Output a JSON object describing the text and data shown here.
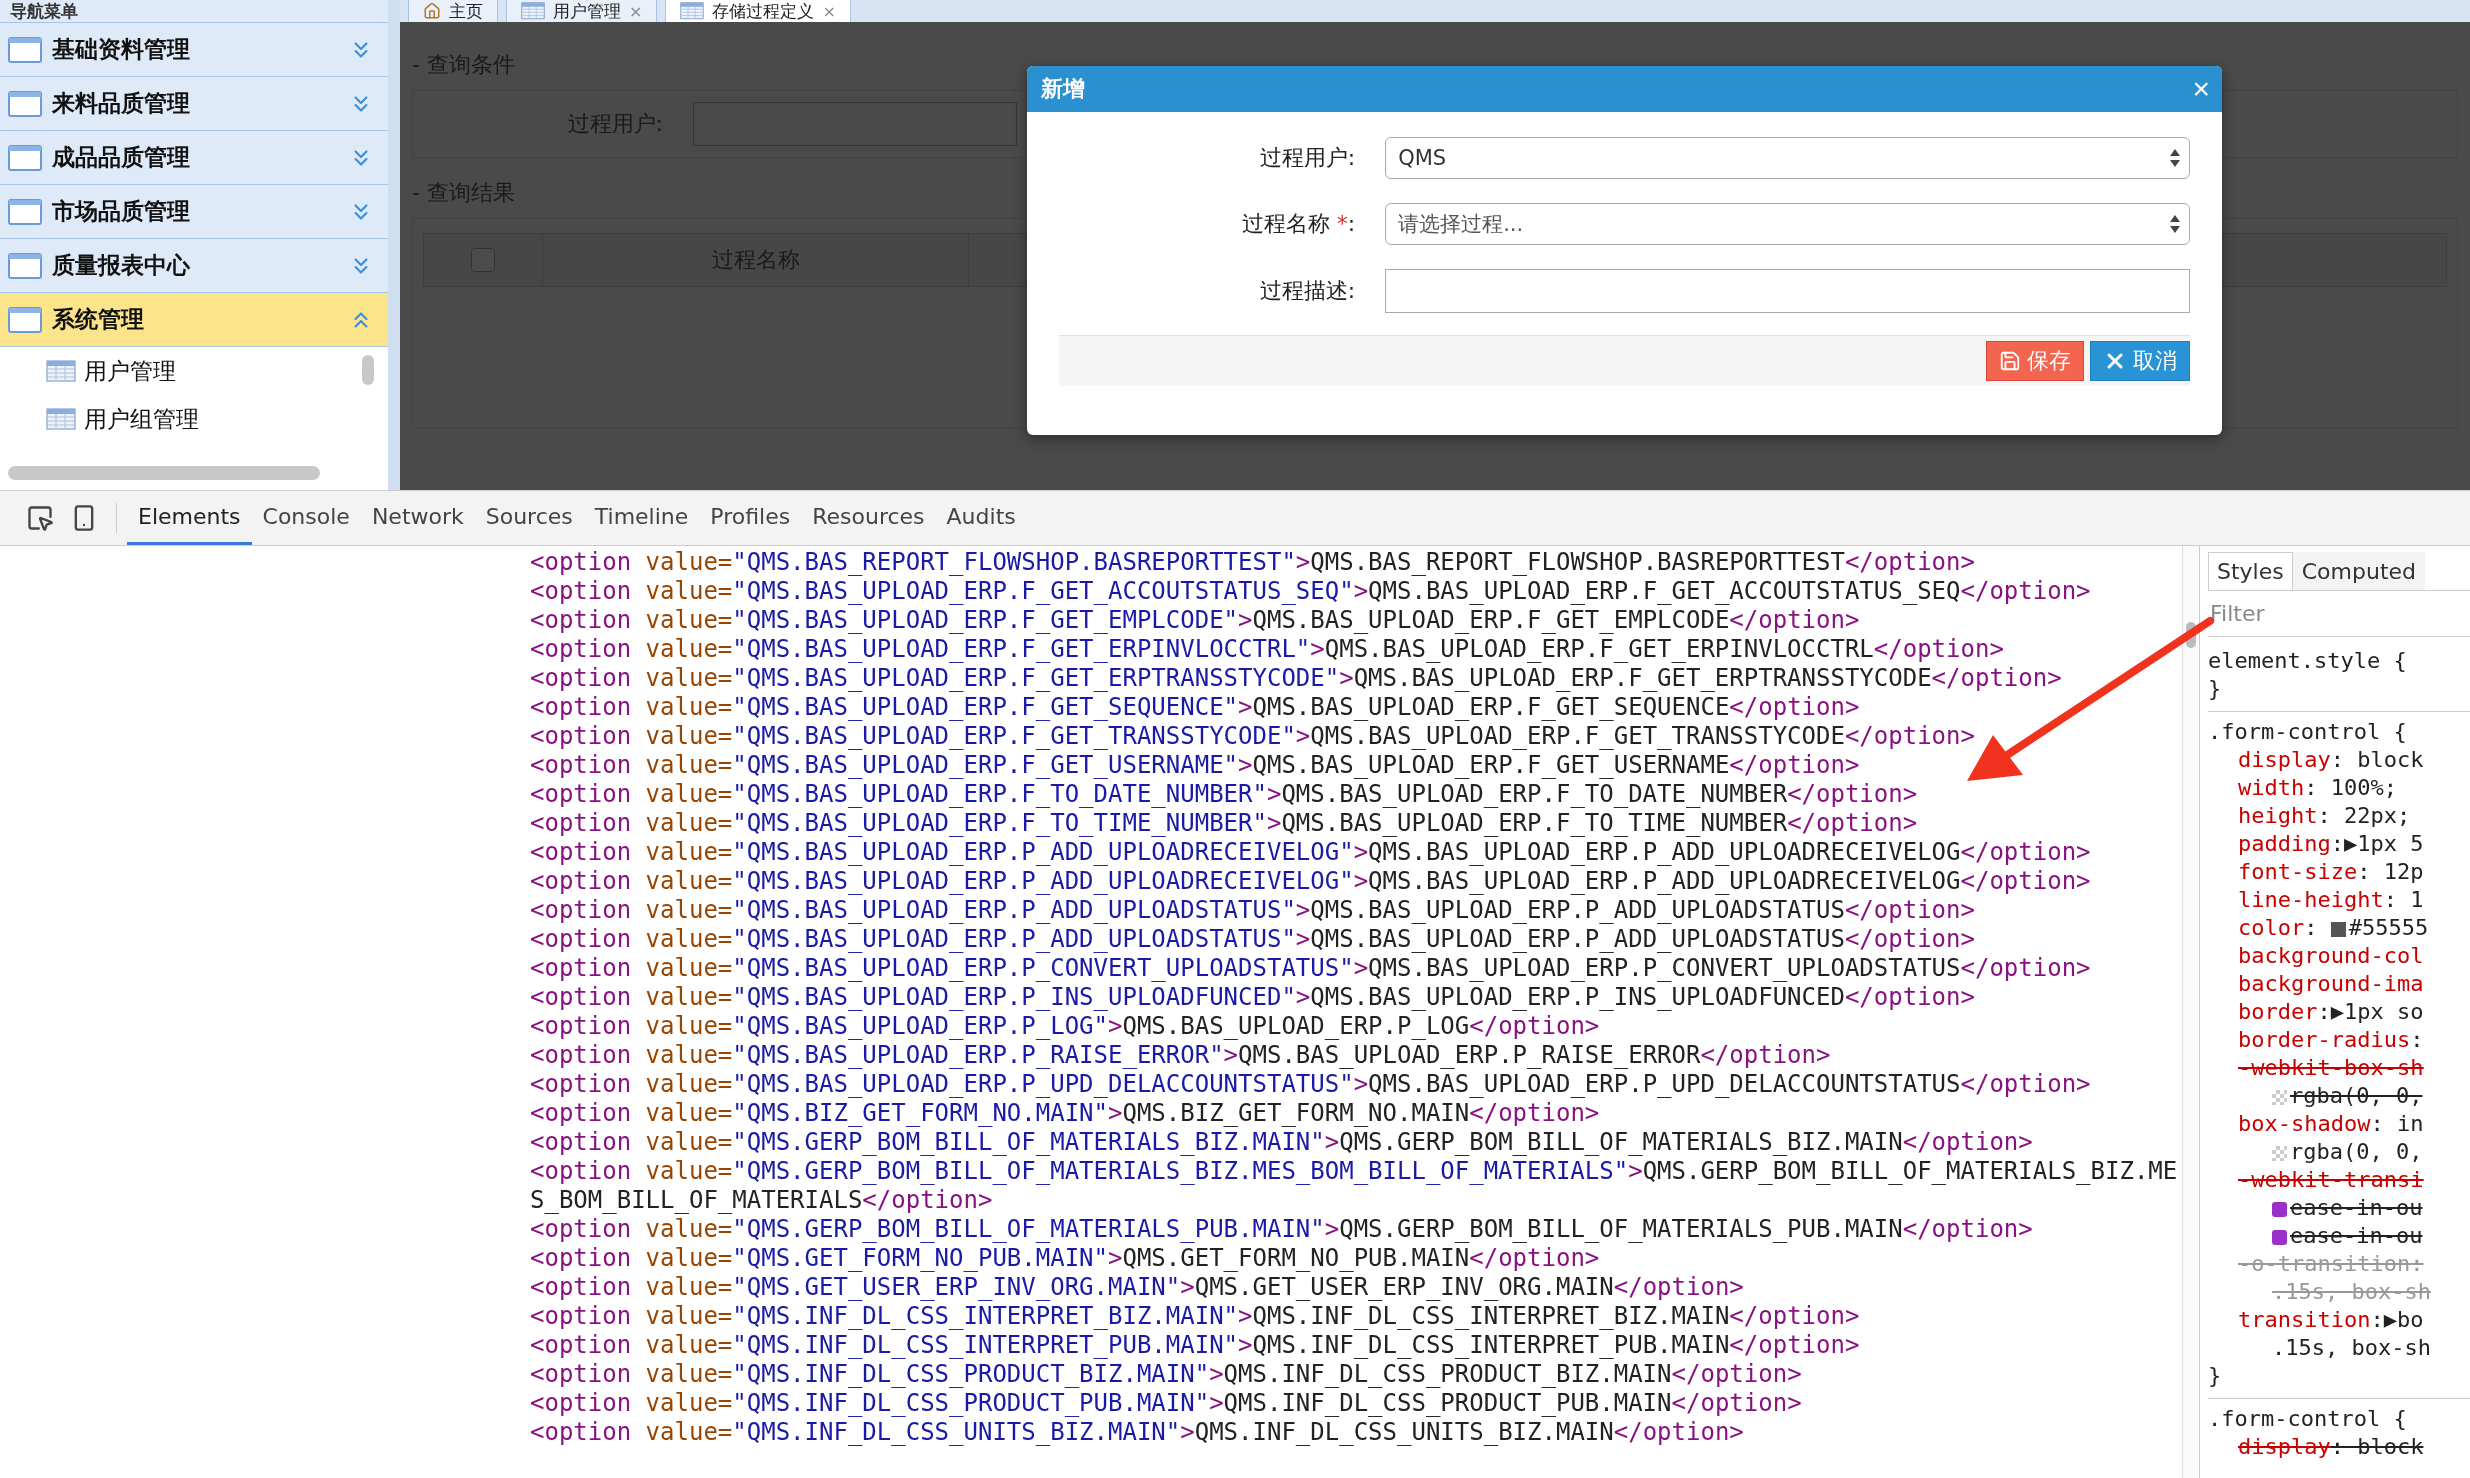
{
  "sidebar": {
    "title": "导航菜单",
    "items": [
      {
        "label": "基础资料管理",
        "expanded": false
      },
      {
        "label": "来料品质管理",
        "expanded": false
      },
      {
        "label": "成品品质管理",
        "expanded": false
      },
      {
        "label": "市场品质管理",
        "expanded": false
      },
      {
        "label": "质量报表中心",
        "expanded": false
      },
      {
        "label": "系统管理",
        "expanded": true,
        "children": [
          {
            "label": "用户管理"
          },
          {
            "label": "用户组管理"
          }
        ]
      }
    ]
  },
  "tabs": [
    {
      "label": "主页",
      "selected": false
    },
    {
      "label": "用户管理",
      "close": "×",
      "selected": false
    },
    {
      "label": "存储过程定义",
      "close": "×",
      "selected": true
    }
  ],
  "query": {
    "title": "- 查询条件",
    "field_label": "过程用户:"
  },
  "results": {
    "title": "- 查询结果",
    "columns": [
      {
        "kind": "checkbox",
        "checked": false
      },
      {
        "kind": "text",
        "label": "过程名称"
      }
    ]
  },
  "dialog": {
    "title": "新增",
    "close": "×",
    "fields": [
      {
        "kind": "select",
        "label": "过程用户",
        "colon": ":",
        "value": "QMS"
      },
      {
        "kind": "select",
        "label": "过程名称",
        "required_mark": "*",
        "colon": ":",
        "placeholder": "请选择过程..."
      },
      {
        "kind": "text",
        "label": "过程描述",
        "colon": ":"
      }
    ],
    "buttons": [
      {
        "label": "保存",
        "kind": "save"
      },
      {
        "label": "取消",
        "kind": "cancel"
      }
    ]
  },
  "devtools": {
    "tabs": [
      {
        "label": "Elements",
        "selected": true
      },
      {
        "label": "Console",
        "selected": false
      },
      {
        "label": "Network",
        "selected": false
      },
      {
        "label": "Sources",
        "selected": false
      },
      {
        "label": "Timeline",
        "selected": false
      },
      {
        "label": "Profiles",
        "selected": false
      },
      {
        "label": "Resources",
        "selected": false
      },
      {
        "label": "Audits",
        "selected": false
      }
    ],
    "code_lines": [
      {
        "open": "<option",
        "attr": "value=",
        "value": "\"QMS.BAS_REPORT_FLOWSHOP.BASREPORTTEST\"",
        "gt": ">",
        "text": "QMS.BAS_REPORT_FLOWSHOP.BASREPORTTEST",
        "close": "</option>"
      },
      {
        "open": "<option",
        "attr": "value=",
        "value": "\"QMS.BAS_UPLOAD_ERP.F_GET_ACCOUTSTATUS_SEQ\"",
        "gt": ">",
        "text": "QMS.BAS_UPLOAD_ERP.F_GET_ACCOUTSTATUS_SEQ",
        "close": "</option>"
      },
      {
        "open": "<option",
        "attr": "value=",
        "value": "\"QMS.BAS_UPLOAD_ERP.F_GET_EMPLCODE\"",
        "gt": ">",
        "text": "QMS.BAS_UPLOAD_ERP.F_GET_EMPLCODE",
        "close": "</option>"
      },
      {
        "open": "<option",
        "attr": "value=",
        "value": "\"QMS.BAS_UPLOAD_ERP.F_GET_ERPINVLOCCTRL\"",
        "gt": ">",
        "text": "QMS.BAS_UPLOAD_ERP.F_GET_ERPINVLOCCTRL",
        "close": "</option>"
      },
      {
        "open": "<option",
        "attr": "value=",
        "value": "\"QMS.BAS_UPLOAD_ERP.F_GET_ERPTRANSSTYCODE\"",
        "gt": ">",
        "text": "QMS.BAS_UPLOAD_ERP.F_GET_ERPTRANSSTYCODE",
        "close": "</option>"
      },
      {
        "open": "<option",
        "attr": "value=",
        "value": "\"QMS.BAS_UPLOAD_ERP.F_GET_SEQUENCE\"",
        "gt": ">",
        "text": "QMS.BAS_UPLOAD_ERP.F_GET_SEQUENCE",
        "close": "</option>"
      },
      {
        "open": "<option",
        "attr": "value=",
        "value": "\"QMS.BAS_UPLOAD_ERP.F_GET_TRANSSTYCODE\"",
        "gt": ">",
        "text": "QMS.BAS_UPLOAD_ERP.F_GET_TRANSSTYCODE",
        "close": "</option>"
      },
      {
        "open": "<option",
        "attr": "value=",
        "value": "\"QMS.BAS_UPLOAD_ERP.F_GET_USERNAME\"",
        "gt": ">",
        "text": "QMS.BAS_UPLOAD_ERP.F_GET_USERNAME",
        "close": "</option>"
      },
      {
        "open": "<option",
        "attr": "value=",
        "value": "\"QMS.BAS_UPLOAD_ERP.F_TO_DATE_NUMBER\"",
        "gt": ">",
        "text": "QMS.BAS_UPLOAD_ERP.F_TO_DATE_NUMBER",
        "close": "</option>"
      },
      {
        "open": "<option",
        "attr": "value=",
        "value": "\"QMS.BAS_UPLOAD_ERP.F_TO_TIME_NUMBER\"",
        "gt": ">",
        "text": "QMS.BAS_UPLOAD_ERP.F_TO_TIME_NUMBER",
        "close": "</option>"
      },
      {
        "open": "<option",
        "attr": "value=",
        "value": "\"QMS.BAS_UPLOAD_ERP.P_ADD_UPLOADRECEIVELOG\"",
        "gt": ">",
        "text": "QMS.BAS_UPLOAD_ERP.P_ADD_UPLOADRECEIVELOG",
        "close": "</option>"
      },
      {
        "open": "<option",
        "attr": "value=",
        "value": "\"QMS.BAS_UPLOAD_ERP.P_ADD_UPLOADRECEIVELOG\"",
        "gt": ">",
        "text": "QMS.BAS_UPLOAD_ERP.P_ADD_UPLOADRECEIVELOG",
        "close": "</option>"
      },
      {
        "open": "<option",
        "attr": "value=",
        "value": "\"QMS.BAS_UPLOAD_ERP.P_ADD_UPLOADSTATUS\"",
        "gt": ">",
        "text": "QMS.BAS_UPLOAD_ERP.P_ADD_UPLOADSTATUS",
        "close": "</option>"
      },
      {
        "open": "<option",
        "attr": "value=",
        "value": "\"QMS.BAS_UPLOAD_ERP.P_ADD_UPLOADSTATUS\"",
        "gt": ">",
        "text": "QMS.BAS_UPLOAD_ERP.P_ADD_UPLOADSTATUS",
        "close": "</option>"
      },
      {
        "open": "<option",
        "attr": "value=",
        "value": "\"QMS.BAS_UPLOAD_ERP.P_CONVERT_UPLOADSTATUS\"",
        "gt": ">",
        "text": "QMS.BAS_UPLOAD_ERP.P_CONVERT_UPLOADSTATUS",
        "close": "</option>"
      },
      {
        "open": "<option",
        "attr": "value=",
        "value": "\"QMS.BAS_UPLOAD_ERP.P_INS_UPLOADFUNCED\"",
        "gt": ">",
        "text": "QMS.BAS_UPLOAD_ERP.P_INS_UPLOADFUNCED",
        "close": "</option>"
      },
      {
        "open": "<option",
        "attr": "value=",
        "value": "\"QMS.BAS_UPLOAD_ERP.P_LOG\"",
        "gt": ">",
        "text": "QMS.BAS_UPLOAD_ERP.P_LOG",
        "close": "</option>"
      },
      {
        "open": "<option",
        "attr": "value=",
        "value": "\"QMS.BAS_UPLOAD_ERP.P_RAISE_ERROR\"",
        "gt": ">",
        "text": "QMS.BAS_UPLOAD_ERP.P_RAISE_ERROR",
        "close": "</option>"
      },
      {
        "open": "<option",
        "attr": "value=",
        "value": "\"QMS.BAS_UPLOAD_ERP.P_UPD_DELACCOUNTSTATUS\"",
        "gt": ">",
        "text": "QMS.BAS_UPLOAD_ERP.P_UPD_DELACCOUNTSTATUS",
        "close": "</option>"
      },
      {
        "open": "<option",
        "attr": "value=",
        "value": "\"QMS.BIZ_GET_FORM_NO.MAIN\"",
        "gt": ">",
        "text": "QMS.BIZ_GET_FORM_NO.MAIN",
        "close": "</option>"
      },
      {
        "open": "<option",
        "attr": "value=",
        "value": "\"QMS.GERP_BOM_BILL_OF_MATERIALS_BIZ.MAIN\"",
        "gt": ">",
        "text": "QMS.GERP_BOM_BILL_OF_MATERIALS_BIZ.MAIN",
        "close": "</option>"
      },
      {
        "open": "<option",
        "attr": "value=",
        "value": "\"QMS.GERP_BOM_BILL_OF_MATERIALS_BIZ.MES_BOM_BILL_OF_MATERIALS\"",
        "gt": ">",
        "text": "QMS.GERP_BOM_BILL_OF_MATERIALS_BIZ.MES_BOM_BILL_OF_MATERIALS",
        "close": "</option>"
      },
      {
        "open": "<option",
        "attr": "value=",
        "value": "\"QMS.GERP_BOM_BILL_OF_MATERIALS_PUB.MAIN\"",
        "gt": ">",
        "text": "QMS.GERP_BOM_BILL_OF_MATERIALS_PUB.MAIN",
        "close": "</option>"
      },
      {
        "open": "<option",
        "attr": "value=",
        "value": "\"QMS.GET_FORM_NO_PUB.MAIN\"",
        "gt": ">",
        "text": "QMS.GET_FORM_NO_PUB.MAIN",
        "close": "</option>"
      },
      {
        "open": "<option",
        "attr": "value=",
        "value": "\"QMS.GET_USER_ERP_INV_ORG.MAIN\"",
        "gt": ">",
        "text": "QMS.GET_USER_ERP_INV_ORG.MAIN",
        "close": "</option>"
      },
      {
        "open": "<option",
        "attr": "value=",
        "value": "\"QMS.INF_DL_CSS_INTERPRET_BIZ.MAIN\"",
        "gt": ">",
        "text": "QMS.INF_DL_CSS_INTERPRET_BIZ.MAIN",
        "close": "</option>"
      },
      {
        "open": "<option",
        "attr": "value=",
        "value": "\"QMS.INF_DL_CSS_INTERPRET_PUB.MAIN\"",
        "gt": ">",
        "text": "QMS.INF_DL_CSS_INTERPRET_PUB.MAIN",
        "close": "</option>"
      },
      {
        "open": "<option",
        "attr": "value=",
        "value": "\"QMS.INF_DL_CSS_PRODUCT_BIZ.MAIN\"",
        "gt": ">",
        "text": "QMS.INF_DL_CSS_PRODUCT_BIZ.MAIN",
        "close": "</option>"
      },
      {
        "open": "<option",
        "attr": "value=",
        "value": "\"QMS.INF_DL_CSS_PRODUCT_PUB.MAIN\"",
        "gt": ">",
        "text": "QMS.INF_DL_CSS_PRODUCT_PUB.MAIN",
        "close": "</option>"
      },
      {
        "open": "<option",
        "attr": "value=",
        "value": "\"QMS.INF_DL_CSS_UNITS_BIZ.MAIN\"",
        "gt": ">",
        "text": "QMS.INF_DL_CSS_UNITS_BIZ.MAIN",
        "close": "</option>"
      }
    ],
    "styles_panel": {
      "tabs": [
        {
          "label": "Styles",
          "selected": true
        },
        {
          "label": "Computed",
          "selected": false
        }
      ],
      "filter_placeholder": "Filter",
      "lines": [
        {
          "kind": "selector",
          "text": "element.style {",
          "divider": false
        },
        {
          "kind": "brace",
          "text": "}"
        },
        {
          "kind": "selector",
          "text": ".form-control {",
          "divider": true
        },
        {
          "kind": "decl",
          "prop": "display",
          "value": ": block",
          "struck": false,
          "dimmed": false
        },
        {
          "kind": "decl",
          "prop": "width",
          "value": ": 100%;",
          "struck": false,
          "dimmed": false
        },
        {
          "kind": "decl",
          "prop": "height",
          "value": ": 22px;",
          "struck": false,
          "dimmed": false
        },
        {
          "kind": "decl",
          "prop": "padding",
          "value": ":▶1px 5",
          "struck": false,
          "dimmed": false
        },
        {
          "kind": "decl",
          "prop": "font-size",
          "value": ": 12p",
          "struck": false,
          "dimmed": false
        },
        {
          "kind": "decl",
          "prop": "line-height",
          "value": ": 1",
          "struck": false,
          "dimmed": false
        },
        {
          "kind": "color_decl",
          "prop": "color",
          "value": ": ",
          "after": "#55555",
          "struck": false,
          "dimmed": false
        },
        {
          "kind": "decl",
          "prop": "background-col",
          "struck": false,
          "dimmed": false
        },
        {
          "kind": "decl",
          "prop": "background-ima",
          "struck": false,
          "dimmed": false
        },
        {
          "kind": "decl",
          "prop": "border",
          "value": ":▶1px so",
          "struck": false,
          "dimmed": false
        },
        {
          "kind": "decl",
          "prop": "border-radius",
          "value": ":",
          "struck": false,
          "dimmed": false
        },
        {
          "kind": "decl",
          "prop": "-webkit-box-sh",
          "struck": true,
          "dimmed": false
        },
        {
          "kind": "shadow_cont",
          "after": "rgba(0, 0,",
          "struck": true,
          "dimmed": false
        },
        {
          "kind": "decl",
          "prop": "box-shadow",
          "value": ": in",
          "struck": false,
          "dimmed": false
        },
        {
          "kind": "shadow_cont",
          "after": "rgba(0, 0,",
          "struck": false,
          "dimmed": false
        },
        {
          "kind": "decl",
          "prop": "-webkit-transi",
          "struck": true,
          "dimmed": false
        },
        {
          "kind": "easing_cont",
          "after": "ease-in-ou",
          "struck": true,
          "dimmed": false
        },
        {
          "kind": "easing_cont",
          "after": "ease-in-ou",
          "struck": true,
          "dimmed": false
        },
        {
          "kind": "decl",
          "prop": "-o-transition",
          "value": ":",
          "struck": true,
          "dimmed": true
        },
        {
          "kind": "cont",
          "after": ".15s, box-sh",
          "struck": true,
          "dimmed": true
        },
        {
          "kind": "decl",
          "prop": "transition",
          "value": ":▶bo",
          "struck": false,
          "dimmed": false
        },
        {
          "kind": "cont",
          "after": ".15s, box-sh",
          "struck": false,
          "dimmed": false
        },
        {
          "kind": "brace",
          "text": "}"
        },
        {
          "kind": "selector",
          "text": ".form-control {",
          "divider": true
        },
        {
          "kind": "decl",
          "prop": "display",
          "value": ": block",
          "struck": true,
          "dimmed": false
        }
      ]
    }
  }
}
